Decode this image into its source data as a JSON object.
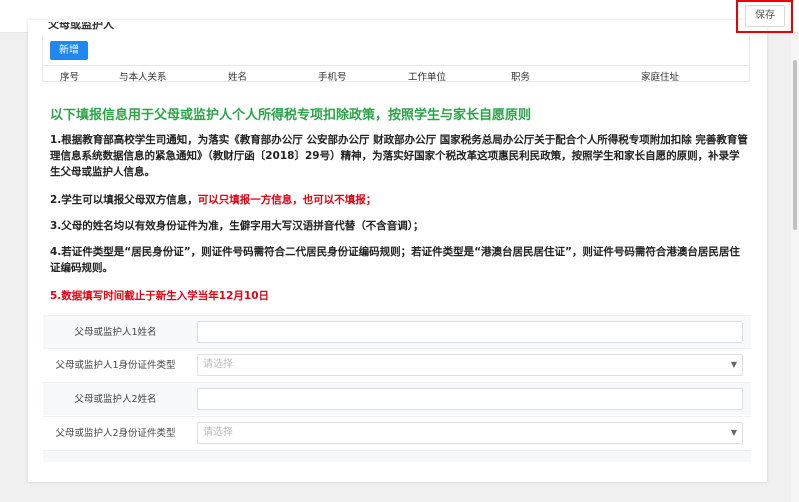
{
  "toolbar": {
    "save_label": "保存"
  },
  "guardian_table": {
    "title": "父母或监护人",
    "add_label": "新增",
    "columns": [
      "序号",
      "与本人关系",
      "姓名",
      "手机号",
      "工作单位",
      "职务",
      "家庭住址"
    ]
  },
  "notice": {
    "title": "以下填报信息用于父母或监护人个人所得税专项扣除政策，按照学生与家长自愿原则",
    "p1": "1.根据教育部高校学生司通知，为落实《教育部办公厅 公安部办公厅 财政部办公厅 国家税务总局办公厅关于配合个人所得税专项附加扣除 完善教育管理信息系统数据信息的紧急通知》（教财厅函〔2018〕29号）精神，为落实好国家个税改革这项惠民利民政策，按照学生和家长自愿的原则，补录学生父母或监护人信息。",
    "p2_a": "2.学生可以填报父母双方信息，",
    "p2_b": "可以只填报一方信息，也可以不填报；",
    "p3": "3.父母的姓名均以有效身份证件为准，生僻字用大写汉语拼音代替（不含音调）；",
    "p4": "4.若证件类型是“居民身份证”，则证件号码需符合二代居民身份证编码规则；若证件类型是“港澳台居民居住证”，则证件号码需符合港澳台居民居住证编码规则。",
    "p5": "5.数据填写时间截止于新生入学当年12月10日"
  },
  "form": {
    "guardian1_name_label": "父母或监护人1姓名",
    "guardian1_name_value": "",
    "guardian1_id_type_label": "父母或监护人1身份证件类型",
    "guardian1_id_type_placeholder": "请选择",
    "guardian2_name_label": "父母或监护人2姓名",
    "guardian2_name_value": "",
    "guardian2_id_type_label": "父母或监护人2身份证件类型",
    "guardian2_id_type_placeholder": "请选择"
  },
  "colors": {
    "primary": "#1e88f0",
    "notice_title": "#2aa447",
    "warning": "#e60012",
    "highlight": "#ee0000"
  }
}
